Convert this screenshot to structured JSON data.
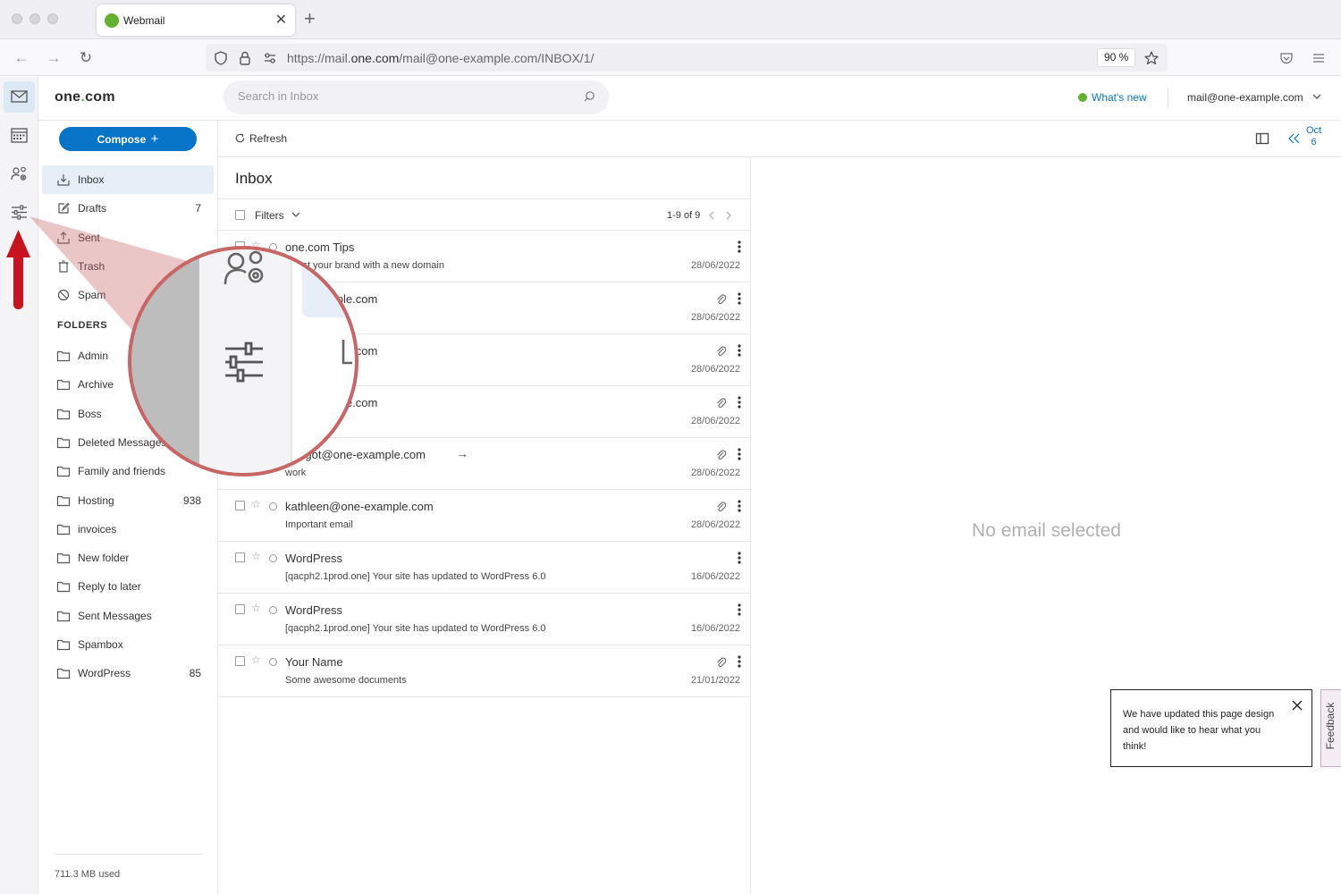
{
  "browser": {
    "tab_title": "Webmail",
    "url_prefix": "https://mail.",
    "url_domain": "one.com",
    "url_path": "/mail@one-example.com/INBOX/1/",
    "zoom": "90 %"
  },
  "app": {
    "logo_text": "one",
    "logo_dot": ".",
    "logo_suffix": "com",
    "search_placeholder": "Search in Inbox",
    "whats_new": "What's new",
    "account": "mail@one-example.com",
    "compose": "Compose",
    "refresh": "Refresh",
    "date_nav": {
      "month": "Oct",
      "day": "6"
    },
    "storage": "711.3 MB used"
  },
  "mailboxes": [
    {
      "label": "Inbox",
      "count": "",
      "icon": "inbox-icon"
    },
    {
      "label": "Drafts",
      "count": "7",
      "icon": "drafts-icon"
    },
    {
      "label": "Sent",
      "count": "",
      "icon": "sent-icon"
    },
    {
      "label": "Trash",
      "count": "",
      "icon": "trash-icon"
    },
    {
      "label": "Spam",
      "count": "",
      "icon": "spam-icon"
    }
  ],
  "folders_heading": "FOLDERS",
  "folders": [
    {
      "label": "Admin",
      "count": ""
    },
    {
      "label": "Archive",
      "count": ""
    },
    {
      "label": "Boss",
      "count": ""
    },
    {
      "label": "Deleted Messages",
      "count": ""
    },
    {
      "label": "Family and friends",
      "count": ""
    },
    {
      "label": "Hosting",
      "count": "938"
    },
    {
      "label": "invoices",
      "count": ""
    },
    {
      "label": "New folder",
      "count": ""
    },
    {
      "label": "Reply to later",
      "count": ""
    },
    {
      "label": "Sent Messages",
      "count": ""
    },
    {
      "label": "Spambox",
      "count": ""
    },
    {
      "label": "WordPress",
      "count": "85"
    }
  ],
  "list": {
    "title": "Inbox",
    "filters": "Filters",
    "pager": "1-9 of 9",
    "emails": [
      {
        "sender": "one.com Tips",
        "subject": "Boost your brand with a new domain",
        "date": "28/06/2022",
        "attachment": false
      },
      {
        "sender": "one-example.com",
        "subject": "",
        "date": "28/06/2022",
        "attachment": true
      },
      {
        "sender": "one-example.com",
        "subject": "",
        "date": "28/06/2022",
        "attachment": true
      },
      {
        "sender": "one-example.com",
        "subject": "",
        "date": "28/06/2022",
        "attachment": true
      },
      {
        "sender": "margot@one-example.com",
        "subject": "work",
        "date": "28/06/2022",
        "attachment": true
      },
      {
        "sender": "kathleen@one-example.com",
        "subject": "Important email",
        "date": "28/06/2022",
        "attachment": true
      },
      {
        "sender": "WordPress",
        "subject": "[qacph2.1prod.one] Your site has updated to WordPress 6.0",
        "date": "16/06/2022",
        "attachment": false
      },
      {
        "sender": "WordPress",
        "subject": "[qacph2.1prod.one] Your site has updated to WordPress 6.0",
        "date": "16/06/2022",
        "attachment": false
      },
      {
        "sender": "Your Name",
        "subject": "Some awesome documents",
        "date": "21/01/2022",
        "attachment": true
      }
    ]
  },
  "reading": {
    "empty": "No email selected"
  },
  "feedback": {
    "popup_text": "We have updated this page design and would like to hear what you think!",
    "tab_label": "Feedback"
  },
  "colors": {
    "accent": "#0874c8",
    "brand_green": "#63b22f",
    "highlight": "#c65b5b",
    "arrow": "#c8141e"
  }
}
